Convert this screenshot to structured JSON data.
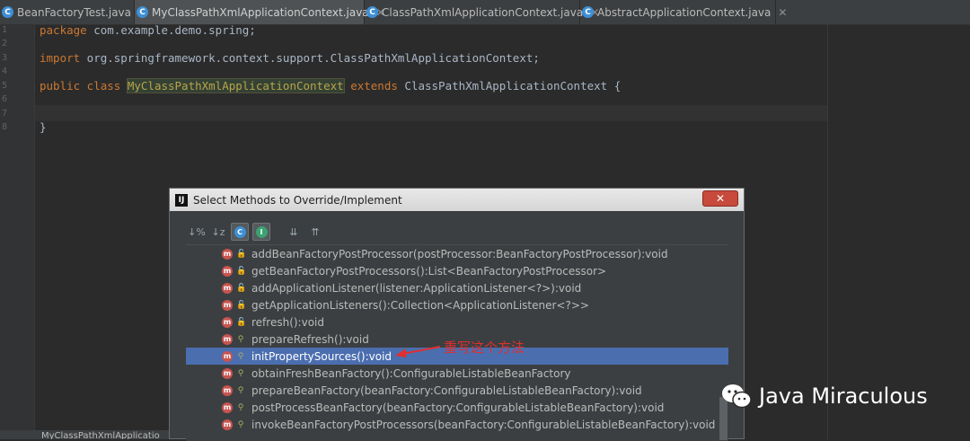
{
  "tabs": [
    {
      "label": "BeanFactoryTest.java",
      "active": false
    },
    {
      "label": "MyClassPathXmlApplicationContext.java",
      "active": true
    },
    {
      "label": "ClassPathXmlApplicationContext.java",
      "active": false
    },
    {
      "label": "AbstractApplicationContext.java",
      "active": false
    }
  ],
  "editor": {
    "line_numbers": [
      "1",
      "2",
      "3",
      "4",
      "5",
      "6",
      "7",
      "8"
    ],
    "code": {
      "l1_kw": "package",
      "l1_rest": " com.example.demo.spring;",
      "l3_kw": "import",
      "l3_rest": " org.springframework.context.support.ClassPathXmlApplicationContext;",
      "l5_kw1": "public class",
      "l5_cls": "MyClassPathXmlApplicationContext",
      "l5_kw2": "extends",
      "l5_rest": " ClassPathXmlApplicationContext {",
      "l8": "}"
    },
    "bottom_tab": "MyClassPathXmlApplicatio"
  },
  "dialog": {
    "logo": "IJ",
    "title": "Select Methods to Override/Implement",
    "close_label": "✕",
    "toolbar": {
      "sort_visibility": "↓%",
      "sort_alpha": "↓z",
      "class_icon": "C",
      "interface_icon": "I",
      "expand_all": "⇊",
      "collapse_all": "⇈"
    },
    "methods": [
      "addBeanFactoryPostProcessor(postProcessor:BeanFactoryPostProcessor):void",
      "getBeanFactoryPostProcessors():List<BeanFactoryPostProcessor>",
      "addApplicationListener(listener:ApplicationListener<?>):void",
      "getApplicationListeners():Collection<ApplicationListener<?>>",
      "refresh():void",
      "prepareRefresh():void",
      "initPropertySources():void",
      "obtainFreshBeanFactory():ConfigurableListableBeanFactory",
      "prepareBeanFactory(beanFactory:ConfigurableListableBeanFactory):void",
      "postProcessBeanFactory(beanFactory:ConfigurableListableBeanFactory):void",
      "invokeBeanFactoryPostProcessors(beanFactory:ConfigurableListableBeanFactory):void"
    ],
    "selected_index": 6,
    "method_icon": "m"
  },
  "annotation": {
    "text": "重写这个方法"
  },
  "watermark": {
    "text": "Java Miraculous"
  },
  "colors": {
    "selection": "#4b6eaf",
    "keyword": "#cc7832",
    "annotation": "#e02f2f",
    "method_icon": "#c75450"
  }
}
